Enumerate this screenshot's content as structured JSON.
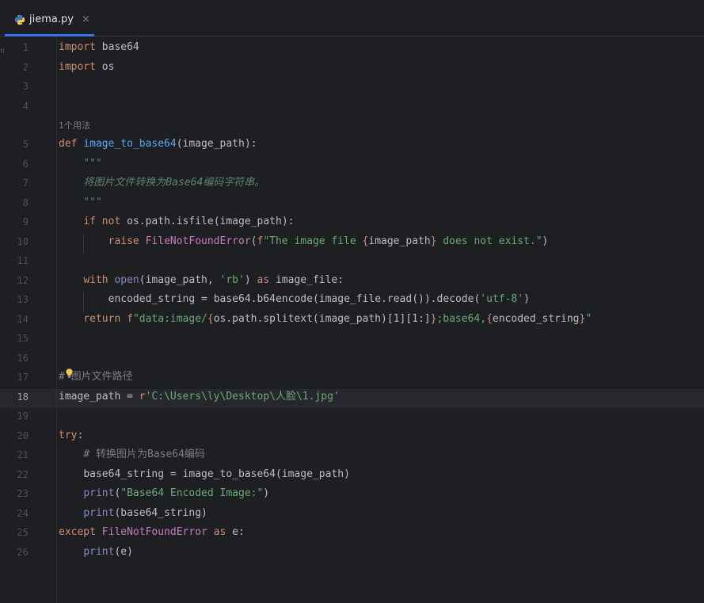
{
  "tab": {
    "filename": "jiema.py",
    "close": "×",
    "icon": "python-file-icon"
  },
  "hint": "1个用法",
  "current_line": 18,
  "lines": [
    {
      "n": "1",
      "code": "import base64"
    },
    {
      "n": "2",
      "code": "import os"
    },
    {
      "n": "3",
      "code": ""
    },
    {
      "n": "4",
      "code": ""
    },
    {
      "n": "5",
      "code": "def image_to_base64(image_path):"
    },
    {
      "n": "6",
      "code": "    \"\"\""
    },
    {
      "n": "7",
      "code": "    将图片文件转换为Base64编码字符串。"
    },
    {
      "n": "8",
      "code": "    \"\"\""
    },
    {
      "n": "9",
      "code": "    if not os.path.isfile(image_path):"
    },
    {
      "n": "10",
      "code": "        raise FileNotFoundError(f\"The image file {image_path} does not exist.\")"
    },
    {
      "n": "11",
      "code": ""
    },
    {
      "n": "12",
      "code": "    with open(image_path, 'rb') as image_file:"
    },
    {
      "n": "13",
      "code": "        encoded_string = base64.b64encode(image_file.read()).decode('utf-8')"
    },
    {
      "n": "14",
      "code": "    return f\"data:image/{os.path.splitext(image_path)[1][1:]};base64,{encoded_string}\""
    },
    {
      "n": "15",
      "code": ""
    },
    {
      "n": "16",
      "code": ""
    },
    {
      "n": "17",
      "code": "# 图片文件路径"
    },
    {
      "n": "18",
      "code": "image_path = r'C:\\Users\\ly\\Desktop\\人脸\\1.jpg'"
    },
    {
      "n": "19",
      "code": ""
    },
    {
      "n": "20",
      "code": "try:"
    },
    {
      "n": "21",
      "code": "    # 转换图片为Base64编码"
    },
    {
      "n": "22",
      "code": "    base64_string = image_to_base64(image_path)"
    },
    {
      "n": "23",
      "code": "    print(\"Base64 Encoded Image:\")"
    },
    {
      "n": "24",
      "code": "    print(base64_string)"
    },
    {
      "n": "25",
      "code": "except FileNotFoundError as e:"
    },
    {
      "n": "26",
      "code": "    print(e)"
    }
  ],
  "colors": {
    "background": "#1e1f22",
    "keyword": "#cf8e6d",
    "function": "#56a8f5",
    "string": "#6aab73",
    "docstring": "#5f826b",
    "comment": "#7a7e85",
    "accent": "#3574f0"
  }
}
